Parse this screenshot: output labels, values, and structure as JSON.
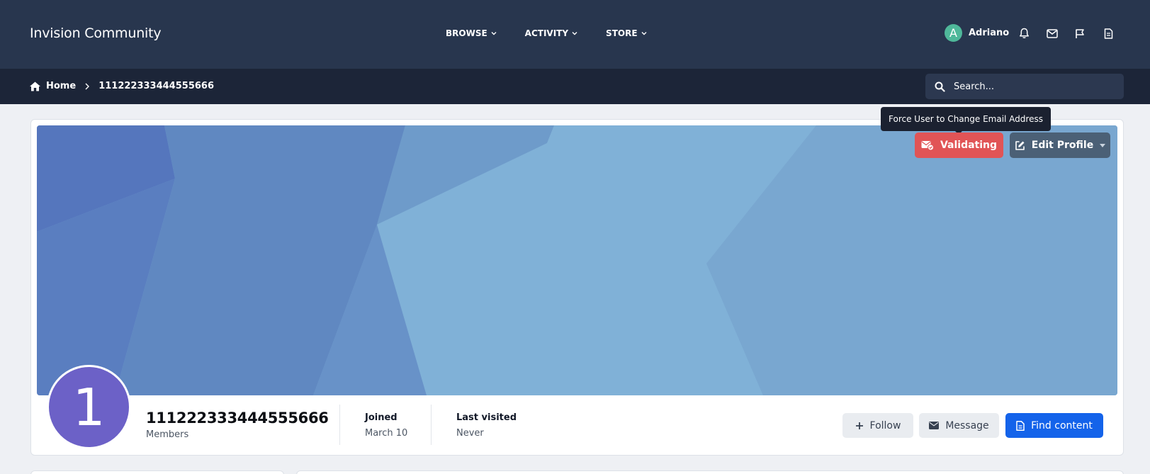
{
  "header": {
    "site_title": "Invision Community",
    "nav": [
      {
        "label": "BROWSE"
      },
      {
        "label": "ACTIVITY"
      },
      {
        "label": "STORE"
      }
    ],
    "user": {
      "avatar_letter": "A",
      "name": "Adriano",
      "avatar_color": "#4fb89a"
    },
    "icons": [
      "bell-icon",
      "envelope-icon",
      "flag-icon",
      "document-icon"
    ]
  },
  "breadcrumb": {
    "home": "Home",
    "current": "111222333444555666"
  },
  "search": {
    "placeholder": "Search..."
  },
  "profile_header": {
    "tooltip": "Force User to Change Email Address",
    "validating_label": "Validating",
    "edit_profile_label": "Edit Profile",
    "avatar_letter": "1",
    "avatar_color": "#6c61c7",
    "name": "111222333444555666",
    "group": "Members",
    "stats": [
      {
        "label": "Joined",
        "value": "March 10"
      },
      {
        "label": "Last visited",
        "value": "Never"
      }
    ],
    "actions": {
      "follow": "Follow",
      "message": "Message",
      "find_content": "Find content"
    }
  },
  "colors": {
    "topbar": "#28364e",
    "breadbar": "#1c2538",
    "validating": "#e15456",
    "edit_profile": "#4b6076",
    "primary": "#1463ea"
  }
}
